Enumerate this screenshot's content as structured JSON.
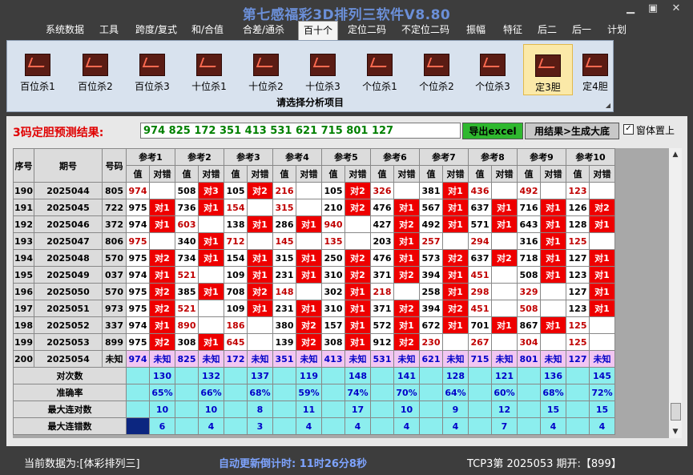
{
  "app": {
    "title": "第七感福彩3D排列三软件V8.80"
  },
  "window": {
    "minimize": "▁",
    "maximize": "▣",
    "close": "✕"
  },
  "menu": [
    "系统数据",
    "工具",
    "跨度/复式",
    "和/合值",
    "合差/通杀",
    "百十个",
    "定位二码",
    "不定位二码",
    "振幅",
    "特征",
    "后二",
    "后一",
    "计划"
  ],
  "menu_active": "百十个",
  "ribbon": {
    "buttons": [
      "百位杀1",
      "百位杀2",
      "百位杀3",
      "十位杀1",
      "十位杀2",
      "十位杀3",
      "个位杀1",
      "个位杀2",
      "个位杀3",
      "定3胆",
      "定4胆"
    ],
    "active": "定3胆",
    "icon": "chart-icon",
    "caption": "请选择分析项目"
  },
  "result": {
    "label": "3码定胆预测结果:",
    "value": "974 825 172 351 413 531 621 715 801 127",
    "export_label": "导出excel",
    "generate_label": "用结果>生成大底",
    "topmost_checked": true,
    "topmost_label": "窗体置上"
  },
  "table": {
    "headers": {
      "seq": "序号",
      "period": "期号",
      "number": "号码",
      "groups": [
        "参考1",
        "参考2",
        "参考3",
        "参考4",
        "参考5",
        "参考6",
        "参考7",
        "参考8",
        "参考9",
        "参考10"
      ],
      "value": "值",
      "check": "对错"
    },
    "rows": [
      {
        "seq": "190",
        "period": "2025044",
        "num": "805",
        "cells": [
          [
            "974",
            ""
          ],
          [
            "508",
            "对3"
          ],
          [
            "105",
            "对2"
          ],
          [
            "216",
            ""
          ],
          [
            "105",
            "对2"
          ],
          [
            "326",
            ""
          ],
          [
            "381",
            "对1"
          ],
          [
            "436",
            ""
          ],
          [
            "492",
            ""
          ],
          [
            "123",
            ""
          ]
        ]
      },
      {
        "seq": "191",
        "period": "2025045",
        "num": "722",
        "cells": [
          [
            "975",
            "对1"
          ],
          [
            "736",
            "对1"
          ],
          [
            "154",
            ""
          ],
          [
            "315",
            ""
          ],
          [
            "210",
            "对2"
          ],
          [
            "476",
            "对1"
          ],
          [
            "567",
            "对1"
          ],
          [
            "637",
            "对1"
          ],
          [
            "716",
            "对1"
          ],
          [
            "126",
            "对2"
          ]
        ]
      },
      {
        "seq": "192",
        "period": "2025046",
        "num": "372",
        "cells": [
          [
            "974",
            "对1"
          ],
          [
            "603",
            ""
          ],
          [
            "138",
            "对1"
          ],
          [
            "286",
            "对1"
          ],
          [
            "940",
            ""
          ],
          [
            "427",
            "对2"
          ],
          [
            "492",
            "对1"
          ],
          [
            "571",
            "对1"
          ],
          [
            "643",
            "对1"
          ],
          [
            "128",
            "对1"
          ]
        ]
      },
      {
        "seq": "193",
        "period": "2025047",
        "num": "806",
        "cells": [
          [
            "975",
            ""
          ],
          [
            "340",
            "对1"
          ],
          [
            "712",
            ""
          ],
          [
            "145",
            ""
          ],
          [
            "135",
            ""
          ],
          [
            "203",
            "对1"
          ],
          [
            "257",
            ""
          ],
          [
            "294",
            ""
          ],
          [
            "316",
            "对1"
          ],
          [
            "125",
            ""
          ]
        ]
      },
      {
        "seq": "194",
        "period": "2025048",
        "num": "570",
        "cells": [
          [
            "975",
            "对2"
          ],
          [
            "734",
            "对1"
          ],
          [
            "154",
            "对1"
          ],
          [
            "315",
            "对1"
          ],
          [
            "250",
            "对2"
          ],
          [
            "476",
            "对1"
          ],
          [
            "573",
            "对2"
          ],
          [
            "637",
            "对2"
          ],
          [
            "718",
            "对1"
          ],
          [
            "127",
            "对1"
          ]
        ]
      },
      {
        "seq": "195",
        "period": "2025049",
        "num": "037",
        "cells": [
          [
            "974",
            "对1"
          ],
          [
            "521",
            ""
          ],
          [
            "109",
            "对1"
          ],
          [
            "231",
            "对1"
          ],
          [
            "310",
            "对2"
          ],
          [
            "371",
            "对2"
          ],
          [
            "394",
            "对1"
          ],
          [
            "451",
            ""
          ],
          [
            "508",
            "对1"
          ],
          [
            "123",
            "对1"
          ]
        ]
      },
      {
        "seq": "196",
        "period": "2025050",
        "num": "570",
        "cells": [
          [
            "975",
            "对2"
          ],
          [
            "385",
            "对1"
          ],
          [
            "708",
            "对2"
          ],
          [
            "148",
            ""
          ],
          [
            "302",
            "对1"
          ],
          [
            "218",
            ""
          ],
          [
            "258",
            "对1"
          ],
          [
            "298",
            ""
          ],
          [
            "329",
            ""
          ],
          [
            "127",
            "对1"
          ]
        ]
      },
      {
        "seq": "197",
        "period": "2025051",
        "num": "973",
        "cells": [
          [
            "975",
            "对2"
          ],
          [
            "521",
            ""
          ],
          [
            "109",
            "对1"
          ],
          [
            "231",
            "对1"
          ],
          [
            "310",
            "对1"
          ],
          [
            "371",
            "对2"
          ],
          [
            "394",
            "对2"
          ],
          [
            "451",
            ""
          ],
          [
            "508",
            ""
          ],
          [
            "123",
            "对1"
          ]
        ]
      },
      {
        "seq": "198",
        "period": "2025052",
        "num": "337",
        "cells": [
          [
            "974",
            "对1"
          ],
          [
            "890",
            ""
          ],
          [
            "186",
            ""
          ],
          [
            "380",
            "对2"
          ],
          [
            "157",
            "对1"
          ],
          [
            "572",
            "对1"
          ],
          [
            "672",
            "对1"
          ],
          [
            "701",
            "对1"
          ],
          [
            "867",
            "对1"
          ],
          [
            "125",
            ""
          ]
        ]
      },
      {
        "seq": "199",
        "period": "2025053",
        "num": "899",
        "cells": [
          [
            "975",
            "对2"
          ],
          [
            "308",
            "对1"
          ],
          [
            "645",
            ""
          ],
          [
            "139",
            "对2"
          ],
          [
            "308",
            "对1"
          ],
          [
            "912",
            "对2"
          ],
          [
            "230",
            ""
          ],
          [
            "267",
            ""
          ],
          [
            "304",
            ""
          ],
          [
            "125",
            ""
          ]
        ]
      }
    ],
    "pending_row": {
      "seq": "200",
      "period": "2025054",
      "num": "未知",
      "values": [
        "974",
        "825",
        "172",
        "351",
        "413",
        "531",
        "621",
        "715",
        "801",
        "127"
      ],
      "check": "未知"
    },
    "stats": [
      {
        "label": "对次数",
        "values": [
          "130",
          "132",
          "137",
          "119",
          "148",
          "141",
          "128",
          "121",
          "136",
          "145"
        ]
      },
      {
        "label": "准确率",
        "values": [
          "65%",
          "66%",
          "68%",
          "59%",
          "74%",
          "70%",
          "64%",
          "60%",
          "68%",
          "72%"
        ]
      },
      {
        "label": "最大连对数",
        "values": [
          "10",
          "10",
          "8",
          "11",
          "17",
          "10",
          "9",
          "12",
          "15",
          "15"
        ]
      },
      {
        "label": "最大连错数",
        "values": [
          "6",
          "4",
          "3",
          "4",
          "4",
          "4",
          "4",
          "7",
          "4",
          "4"
        ]
      }
    ]
  },
  "status": {
    "data_source": "当前数据为:[体彩排列三]",
    "countdown": "自动更新倒计时: 11时26分8秒",
    "period_info": "TCP3第 2025053 期开:【899】"
  },
  "colors": {
    "hit": "#ee0000",
    "pending": "#f2c6f2",
    "stats": "#8ceeee",
    "result_text": "#008000",
    "title": "#6b8fd8"
  }
}
